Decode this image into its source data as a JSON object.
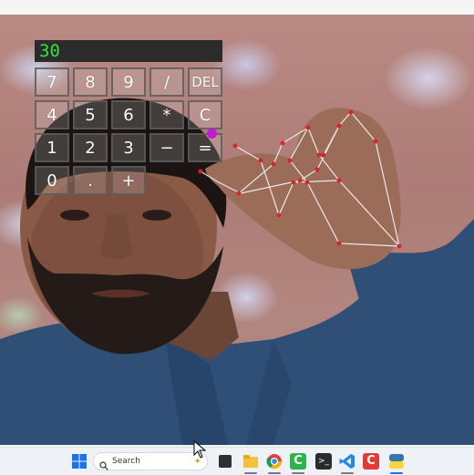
{
  "calculator": {
    "display": "30",
    "keys": [
      [
        "7",
        "8",
        "9",
        "/",
        "DEL"
      ],
      [
        "4",
        "5",
        "6",
        "*",
        "C"
      ],
      [
        "1",
        "2",
        "3",
        "−",
        "="
      ],
      [
        "0",
        ".",
        "+"
      ]
    ]
  },
  "taskbar": {
    "search_label": "Search",
    "icons": [
      "windows-start-icon",
      "search-icon",
      "task-view-icon",
      "file-explorer-icon",
      "chrome-icon",
      "camtasia-icon",
      "terminal-icon",
      "vscode-icon",
      "red-app-icon",
      "python-icon"
    ]
  },
  "colors": {
    "display_text": "#37e23b",
    "landmark_point": "#d9252f",
    "skeleton_line": "#e8e8e8",
    "cursor_marker": "#c21bd6"
  }
}
